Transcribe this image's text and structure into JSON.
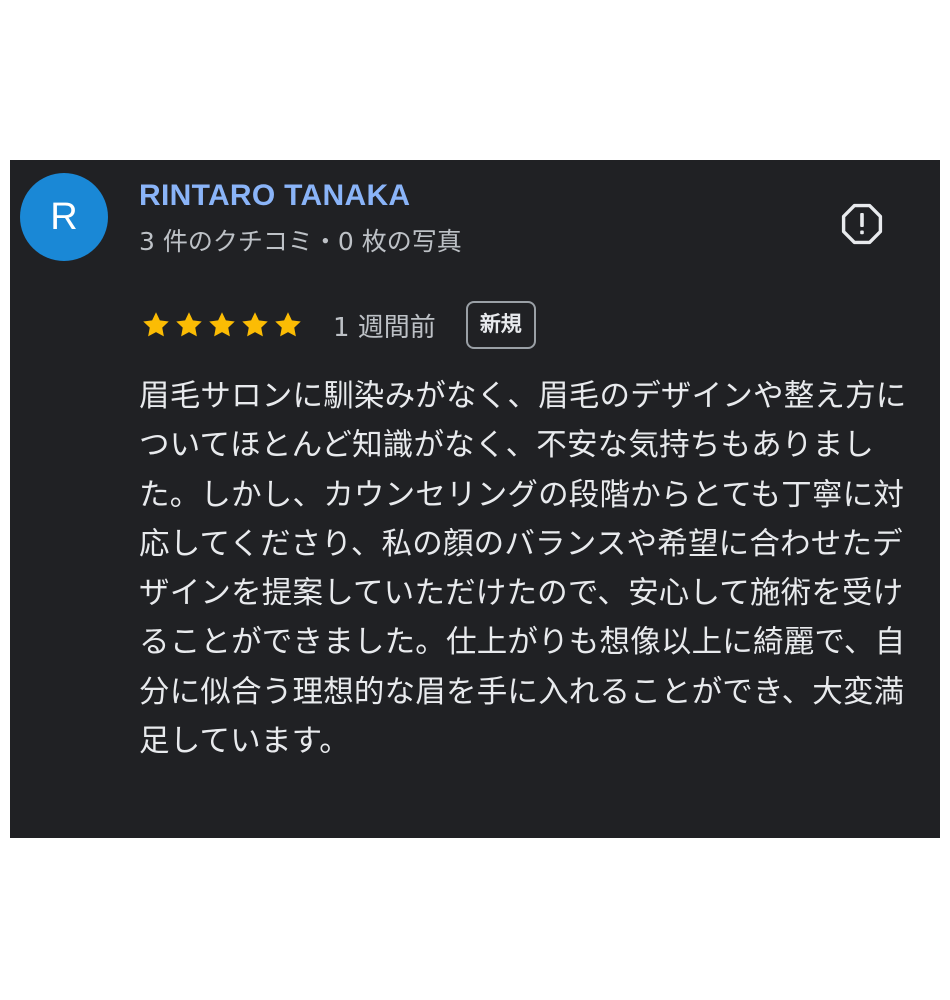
{
  "reviewer": {
    "avatar_letter": "R",
    "avatar_color": "#1a88d6",
    "name": "RINTARO TANAKA",
    "stats": "3 件のクチコミ・0 枚の写真"
  },
  "review": {
    "rating": 5,
    "max_rating": 5,
    "date": "1 週間前",
    "badge": "新規",
    "text": "眉毛サロンに馴染みがなく、眉毛のデザインや整え方についてほとんど知識がなく、不安な気持ちもありました。しかし、カウンセリングの段階からとても丁寧に対応してくださり、私の顔のバランスや希望に合わせたデザインを提案していただけたので、安心して施術を受けることができました。仕上がりも想像以上に綺麗で、自分に似合う理想的な眉を手に入れることができ、大変満足しています。"
  },
  "icons": {
    "report": "report-icon",
    "star": "star-icon"
  },
  "colors": {
    "card_background": "#202124",
    "name": "#8ab4f8",
    "star": "#fbbc04",
    "text": "#e8eaed",
    "secondary_text": "#bdc1c6"
  }
}
